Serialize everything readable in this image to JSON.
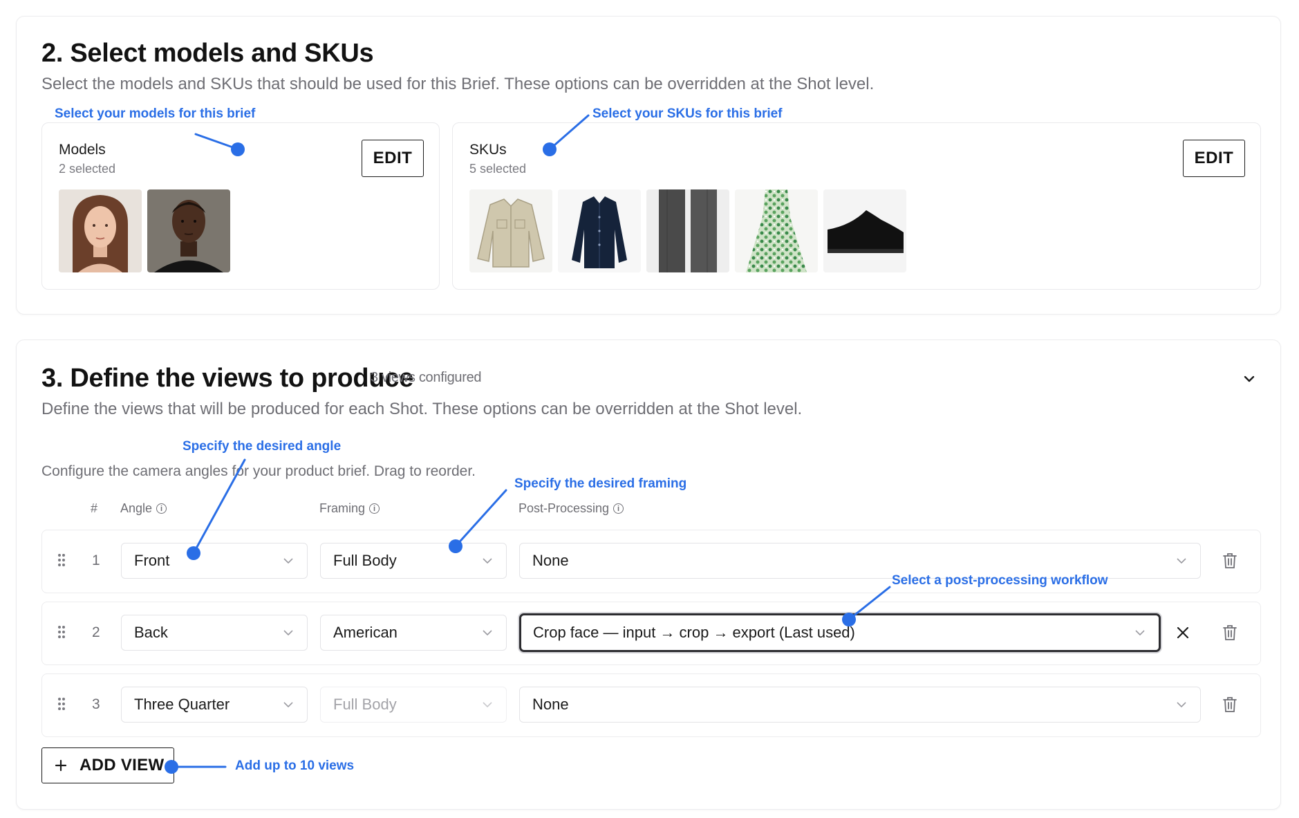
{
  "section2": {
    "title": "2. Select models and SKUs",
    "description": "Select the models and SKUs that should be used for this Brief. These options can be overridden at the Shot level.",
    "models": {
      "title": "Models",
      "count": "2 selected",
      "edit_label": "EDIT",
      "annotation": "Select your models for this brief"
    },
    "skus": {
      "title": "SKUs",
      "count": "5 selected",
      "edit_label": "EDIT",
      "annotation": "Select your SKUs for this brief"
    }
  },
  "section3": {
    "title": "3. Define the views to produce",
    "badge": "3 views configured",
    "description": "Define the views that will be produced for each Shot. These options can be overridden at the Shot level.",
    "helper": "Configure the camera angles for your product brief. Drag to reorder.",
    "columns": {
      "num": "#",
      "angle": "Angle",
      "framing": "Framing",
      "post": "Post-Processing"
    },
    "rows": [
      {
        "num": "1",
        "angle": "Front",
        "framing": "Full Body",
        "post": "None"
      },
      {
        "num": "2",
        "angle": "Back",
        "framing": "American",
        "post": "Crop face — input → crop → export (Last used)"
      },
      {
        "num": "3",
        "angle": "Three Quarter",
        "framing": "Full Body",
        "post": "None"
      }
    ],
    "add_view_label": "ADD VIEW",
    "annotations": {
      "angle": "Specify the desired angle",
      "framing": "Specify the desired framing",
      "post": "Select a post-processing workflow",
      "add": "Add up to 10 views"
    }
  },
  "colors": {
    "annotation_blue": "#2a6ee6",
    "text_muted": "#6e6e74",
    "border": "#e9e9ec"
  }
}
